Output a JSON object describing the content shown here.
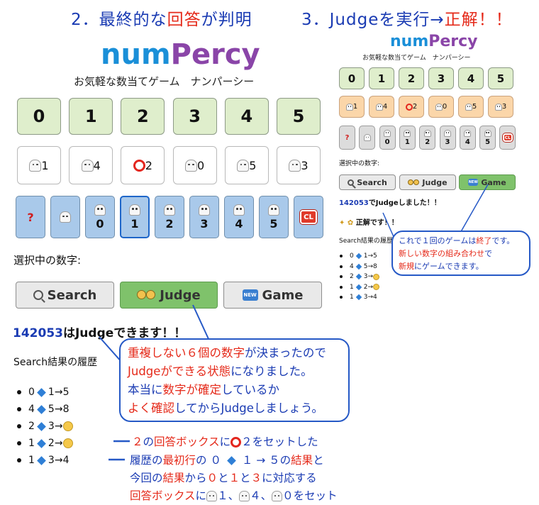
{
  "headings": {
    "left": {
      "prefix": "2．最終的な",
      "highlight": "回答",
      "suffix": "が判明"
    },
    "right": {
      "prefix": "3．Judgeを実行→",
      "highlight": "正解！！"
    }
  },
  "app": {
    "logo_part1": "num",
    "logo_part2": "Percy",
    "subtitle": "お気軽な数当てゲーム　ナンパーシー"
  },
  "left": {
    "number_buttons": [
      "0",
      "1",
      "2",
      "3",
      "4",
      "5"
    ],
    "answer_boxes": [
      {
        "icon": "ghost",
        "value": "1"
      },
      {
        "icon": "ghost",
        "value": "4"
      },
      {
        "icon": "ring",
        "value": "2"
      },
      {
        "icon": "ghost",
        "value": "0"
      },
      {
        "icon": "ghost",
        "value": "5"
      },
      {
        "icon": "ghost",
        "value": "3"
      }
    ],
    "selector_row": [
      {
        "kind": "question",
        "label": "?"
      },
      {
        "kind": "ghost",
        "label": ""
      },
      {
        "kind": "ghost",
        "label": "0"
      },
      {
        "kind": "ghost",
        "label": "1",
        "active": true
      },
      {
        "kind": "ghost",
        "label": "2"
      },
      {
        "kind": "ghost",
        "label": "3"
      },
      {
        "kind": "ghost",
        "label": "4"
      },
      {
        "kind": "ghost",
        "label": "5"
      },
      {
        "kind": "clear",
        "label": "CL"
      }
    ],
    "selected_label": "選択中の数字:",
    "actions": {
      "search": "Search",
      "judge": "Judge",
      "game": "Game",
      "new_badge": "NEW"
    },
    "status_number": "142053",
    "status_text": "はJudgeできます！！",
    "history_title": "Search結果の履歴",
    "history": [
      {
        "a": "0",
        "b": "1",
        "r": "5"
      },
      {
        "a": "4",
        "b": "5",
        "r": "8"
      },
      {
        "a": "2",
        "b": "3",
        "r": "sleepy"
      },
      {
        "a": "1",
        "b": "2",
        "r": "sleepy"
      },
      {
        "a": "1",
        "b": "3",
        "r": "4"
      }
    ]
  },
  "right": {
    "number_buttons": [
      "0",
      "1",
      "2",
      "3",
      "4",
      "5"
    ],
    "answer_boxes": [
      {
        "icon": "ghost",
        "value": "1"
      },
      {
        "icon": "ghost",
        "value": "4"
      },
      {
        "icon": "ring",
        "value": "2"
      },
      {
        "icon": "ghost",
        "value": "0"
      },
      {
        "icon": "ghost",
        "value": "5"
      },
      {
        "icon": "ghost",
        "value": "3"
      }
    ],
    "selector_row": [
      {
        "kind": "question",
        "label": "?"
      },
      {
        "kind": "ghost",
        "label": ""
      },
      {
        "kind": "ghost",
        "label": "0"
      },
      {
        "kind": "ghost",
        "label": "1"
      },
      {
        "kind": "ghost",
        "label": "2"
      },
      {
        "kind": "ghost",
        "label": "3"
      },
      {
        "kind": "ghost",
        "label": "4"
      },
      {
        "kind": "ghost",
        "label": "5"
      },
      {
        "kind": "clear",
        "label": "CL"
      }
    ],
    "selected_label": "選択中の数字:",
    "actions": {
      "search": "Search",
      "judge": "Judge",
      "game": "Game",
      "new_badge": "NEW"
    },
    "status_number": "142053",
    "status_text": "でJudgeしました！！",
    "result_text": "正解です！！",
    "history_title": "Search結果の履歴",
    "history": [
      {
        "a": "0",
        "b": "1",
        "r": "5"
      },
      {
        "a": "4",
        "b": "5",
        "r": "8"
      },
      {
        "a": "2",
        "b": "3",
        "r": "sleepy"
      },
      {
        "a": "1",
        "b": "2",
        "r": "sleepy"
      },
      {
        "a": "1",
        "b": "3",
        "r": "4"
      }
    ]
  },
  "callouts": {
    "main": [
      [
        {
          "t": "重複しない６個の数字",
          "c": "red"
        },
        {
          "t": "が決まったので",
          "c": "blue"
        }
      ],
      [
        {
          "t": "Judgeができる状態",
          "c": "red"
        },
        {
          "t": "になりました。",
          "c": "blue"
        }
      ],
      [
        {
          "t": "本当に",
          "c": "blue"
        },
        {
          "t": "数字が確定",
          "c": "red"
        },
        {
          "t": "しているか",
          "c": "blue"
        }
      ],
      [
        {
          "t": "よく確認",
          "c": "red"
        },
        {
          "t": "してからJudgeしましょう。",
          "c": "blue"
        }
      ]
    ],
    "right": [
      [
        {
          "t": "これで１回のゲームは",
          "c": "blue"
        },
        {
          "t": "終了",
          "c": "red"
        },
        {
          "t": "です。",
          "c": "blue"
        }
      ],
      [
        {
          "t": "新しい数字の組み合わせ",
          "c": "red"
        },
        {
          "t": "で",
          "c": "blue"
        }
      ],
      [
        {
          "t": "新規",
          "c": "red"
        },
        {
          "t": "にゲームできます。",
          "c": "blue"
        }
      ]
    ]
  },
  "notes": {
    "note1": [
      {
        "t": "２",
        "c": "red"
      },
      {
        "t": "の",
        "c": "blue"
      },
      {
        "t": "回答ボックス",
        "c": "red"
      },
      {
        "t": "に",
        "c": "blue"
      },
      {
        "t": "ring",
        "c": "icon"
      },
      {
        "t": "２をセットした",
        "c": "blue"
      }
    ],
    "note2a": [
      {
        "t": "履歴の",
        "c": "blue"
      },
      {
        "t": "最初行",
        "c": "red"
      },
      {
        "t": "の ０ ",
        "c": "blue"
      },
      {
        "t": "diamond",
        "c": "icon"
      },
      {
        "t": " １ → ５の",
        "c": "blue"
      },
      {
        "t": "結果",
        "c": "red"
      },
      {
        "t": "と",
        "c": "blue"
      }
    ],
    "note2b": [
      {
        "t": "今回の",
        "c": "blue"
      },
      {
        "t": "結果",
        "c": "red"
      },
      {
        "t": "から",
        "c": "blue"
      },
      {
        "t": "０",
        "c": "red"
      },
      {
        "t": "と",
        "c": "blue"
      },
      {
        "t": "１",
        "c": "red"
      },
      {
        "t": "と",
        "c": "blue"
      },
      {
        "t": "３",
        "c": "red"
      },
      {
        "t": "に対応する",
        "c": "blue"
      }
    ],
    "note2c": [
      {
        "t": "回答ボックス",
        "c": "red"
      },
      {
        "t": "に",
        "c": "blue"
      },
      {
        "t": "ghost",
        "c": "icon"
      },
      {
        "t": "１、",
        "c": "blue"
      },
      {
        "t": "ghost",
        "c": "icon"
      },
      {
        "t": "４、",
        "c": "blue"
      },
      {
        "t": "ghost",
        "c": "icon"
      },
      {
        "t": "０をセット",
        "c": "blue"
      }
    ]
  },
  "colors": {
    "red": "#e52a1a",
    "blue": "#1a3bb3",
    "button_green": "#dfeecc",
    "selector_blue": "#a9c9ea",
    "answer_orange": "#fbd6a9"
  }
}
